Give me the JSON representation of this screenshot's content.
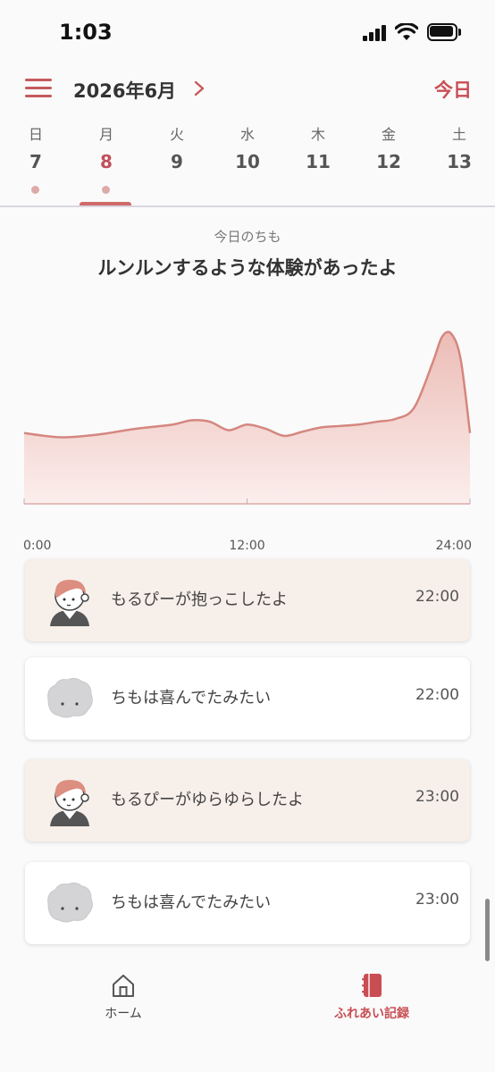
{
  "status_bar": {
    "time": "1:03"
  },
  "header": {
    "month": "2026年6月",
    "today_label": "今日"
  },
  "week": [
    {
      "dow": "日",
      "num": "7",
      "has_record": true,
      "selected": false
    },
    {
      "dow": "月",
      "num": "8",
      "has_record": true,
      "selected": true
    },
    {
      "dow": "火",
      "num": "9",
      "has_record": false,
      "selected": false
    },
    {
      "dow": "水",
      "num": "10",
      "has_record": false,
      "selected": false
    },
    {
      "dow": "木",
      "num": "11",
      "has_record": false,
      "selected": false
    },
    {
      "dow": "金",
      "num": "12",
      "has_record": false,
      "selected": false
    },
    {
      "dow": "土",
      "num": "13",
      "has_record": false,
      "selected": false
    }
  ],
  "mood": {
    "caption": "今日のちも",
    "text": "ルンルンするような体験があったよ"
  },
  "chart_data": {
    "type": "area",
    "x_ticks": [
      "0:00",
      "12:00",
      "24:00"
    ],
    "x": [
      0,
      2,
      4,
      6,
      8,
      9,
      10,
      11,
      12,
      13,
      14,
      15,
      16,
      17,
      18,
      19,
      20,
      21,
      22,
      22.5,
      23,
      23.5,
      24
    ],
    "y": [
      50,
      47,
      49,
      53,
      56,
      59,
      58,
      52,
      56,
      53,
      48,
      51,
      54,
      55,
      56,
      58,
      60,
      68,
      100,
      118,
      120,
      102,
      50
    ],
    "ylim": [
      0,
      135
    ],
    "grid": false,
    "colors": {
      "line": "#d4877f",
      "fill_top": "#ecbcb6",
      "fill_bottom": "#fbeeec"
    }
  },
  "records": [
    {
      "actor": "person",
      "message": "もるぴーが抱っこしたよ",
      "time": "22:00"
    },
    {
      "actor": "chimo",
      "message": "ちもは喜んでたみたい",
      "time": "22:00"
    },
    {
      "actor": "person",
      "message": "もるぴーがゆらゆらしたよ",
      "time": "23:00"
    },
    {
      "actor": "chimo",
      "message": "ちもは喜んでたみたい",
      "time": "23:00"
    }
  ],
  "tabbar": {
    "home_label": "ホーム",
    "records_label": "ふれあい記録",
    "active_color": "#c94e54"
  },
  "colors": {
    "accent": "#c94e54",
    "person_card": "#f7efe9"
  }
}
